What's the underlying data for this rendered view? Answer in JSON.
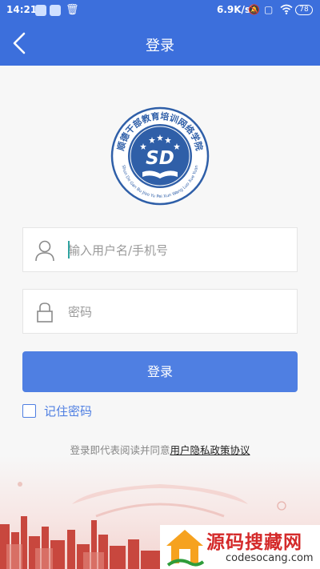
{
  "status_bar": {
    "time": "14:21",
    "net_speed": "6.9K/s",
    "battery": "78",
    "icons": [
      "app-notification-icon",
      "app-notification-icon",
      "trash-icon",
      "mute-icon",
      "sim-icon",
      "wifi-icon",
      "battery-icon"
    ]
  },
  "header": {
    "title": "登录",
    "back_icon": "chevron-left-icon"
  },
  "logo": {
    "arc_text": "顺德干部教育培训网络学院",
    "initials": "SD",
    "pinyin": "Shun De Gan Bu Jiao Yu Pei Xun Wang Luo Xue Yuan"
  },
  "form": {
    "username_placeholder": "输入用户名/手机号",
    "username_value": "",
    "password_placeholder": "密码",
    "password_value": "",
    "login_label": "登录",
    "remember_label": "记住密码",
    "remember_checked": false
  },
  "agreement": {
    "prefix": "登录即代表阅读并同意",
    "link": "用户隐私政策协议"
  },
  "watermark": {
    "title": "源码搜藏网",
    "domain": "codesocang.com"
  },
  "colors": {
    "primary": "#3c6fdc",
    "button": "#4f7fe2",
    "background": "#f7f7f7",
    "logo_blue": "#2f5fa8",
    "watermark_red": "#d42a2a"
  }
}
